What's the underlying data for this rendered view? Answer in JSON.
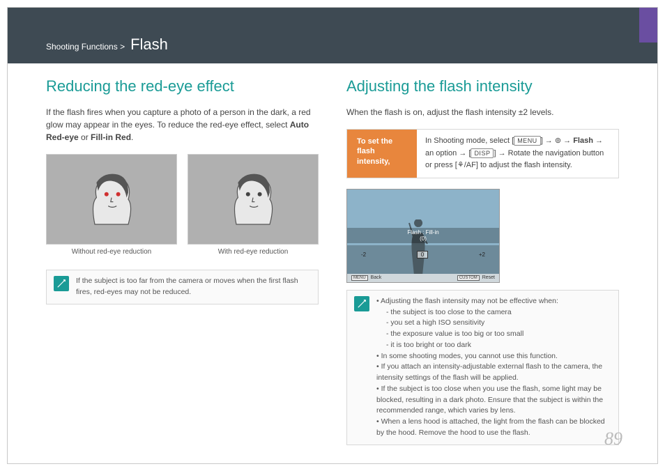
{
  "breadcrumb": {
    "path": "Shooting Functions >",
    "section": "Flash"
  },
  "left": {
    "heading": "Reducing the red-eye effect",
    "intro_1": "If the flash fires when you capture a photo of a person in the dark, a red glow may appear in the eyes. To reduce the red-eye effect, select ",
    "bold_1": "Auto Red-eye",
    "or": " or ",
    "bold_2": "Fill-in Red",
    "period": ".",
    "fig1_cap": "Without red-eye reduction",
    "fig2_cap": "With red-eye reduction",
    "note": "If the subject is too far from the camera or moves when the first flash fires, red-eyes may not be reduced."
  },
  "right": {
    "heading": "Adjusting the flash intensity",
    "intro": "When the flash is on, adjust the flash intensity ±2 levels.",
    "set_label": "To set the flash intensity,",
    "set_body_1": "In Shooting mode, select [",
    "set_body_menu": "MENU",
    "set_body_2": "] → ",
    "set_body_cam": "⊚",
    "set_body_3": " → ",
    "set_body_flash": "Flash",
    "set_body_4": " → an option → [",
    "set_body_disp": "DISP",
    "set_body_5": "] → Rotate the navigation button or press [",
    "set_body_icons": "⚘/AF",
    "set_body_6": "] to adjust the flash intensity.",
    "preview": {
      "title": "Flash : Fill-in",
      "value": "(0)",
      "minus": "-2",
      "mid": "0",
      "plus": "+2",
      "btn_back_icon": "MENU",
      "btn_back": "Back",
      "btn_reset_icon": "CUSTOM",
      "btn_reset": "Reset"
    },
    "notes": {
      "n1": "Adjusting the flash intensity may not be effective when:",
      "s1": "the subject is too close to the camera",
      "s2": "you set a high ISO sensitivity",
      "s3": "the exposure value is too big or too small",
      "s4": "it is too bright or too dark",
      "n2": "In some shooting modes, you cannot use this function.",
      "n3": "If you attach an intensity-adjustable external flash to the camera, the intensity settings of the flash will be applied.",
      "n4": "If the subject is too close when you use the flash, some light may be blocked, resulting in a dark photo. Ensure that the subject is within the recommended range, which varies by lens.",
      "n5": "When a lens hood is attached, the light from the flash can be blocked by the hood. Remove the hood to use the flash."
    }
  },
  "page_number": "89"
}
